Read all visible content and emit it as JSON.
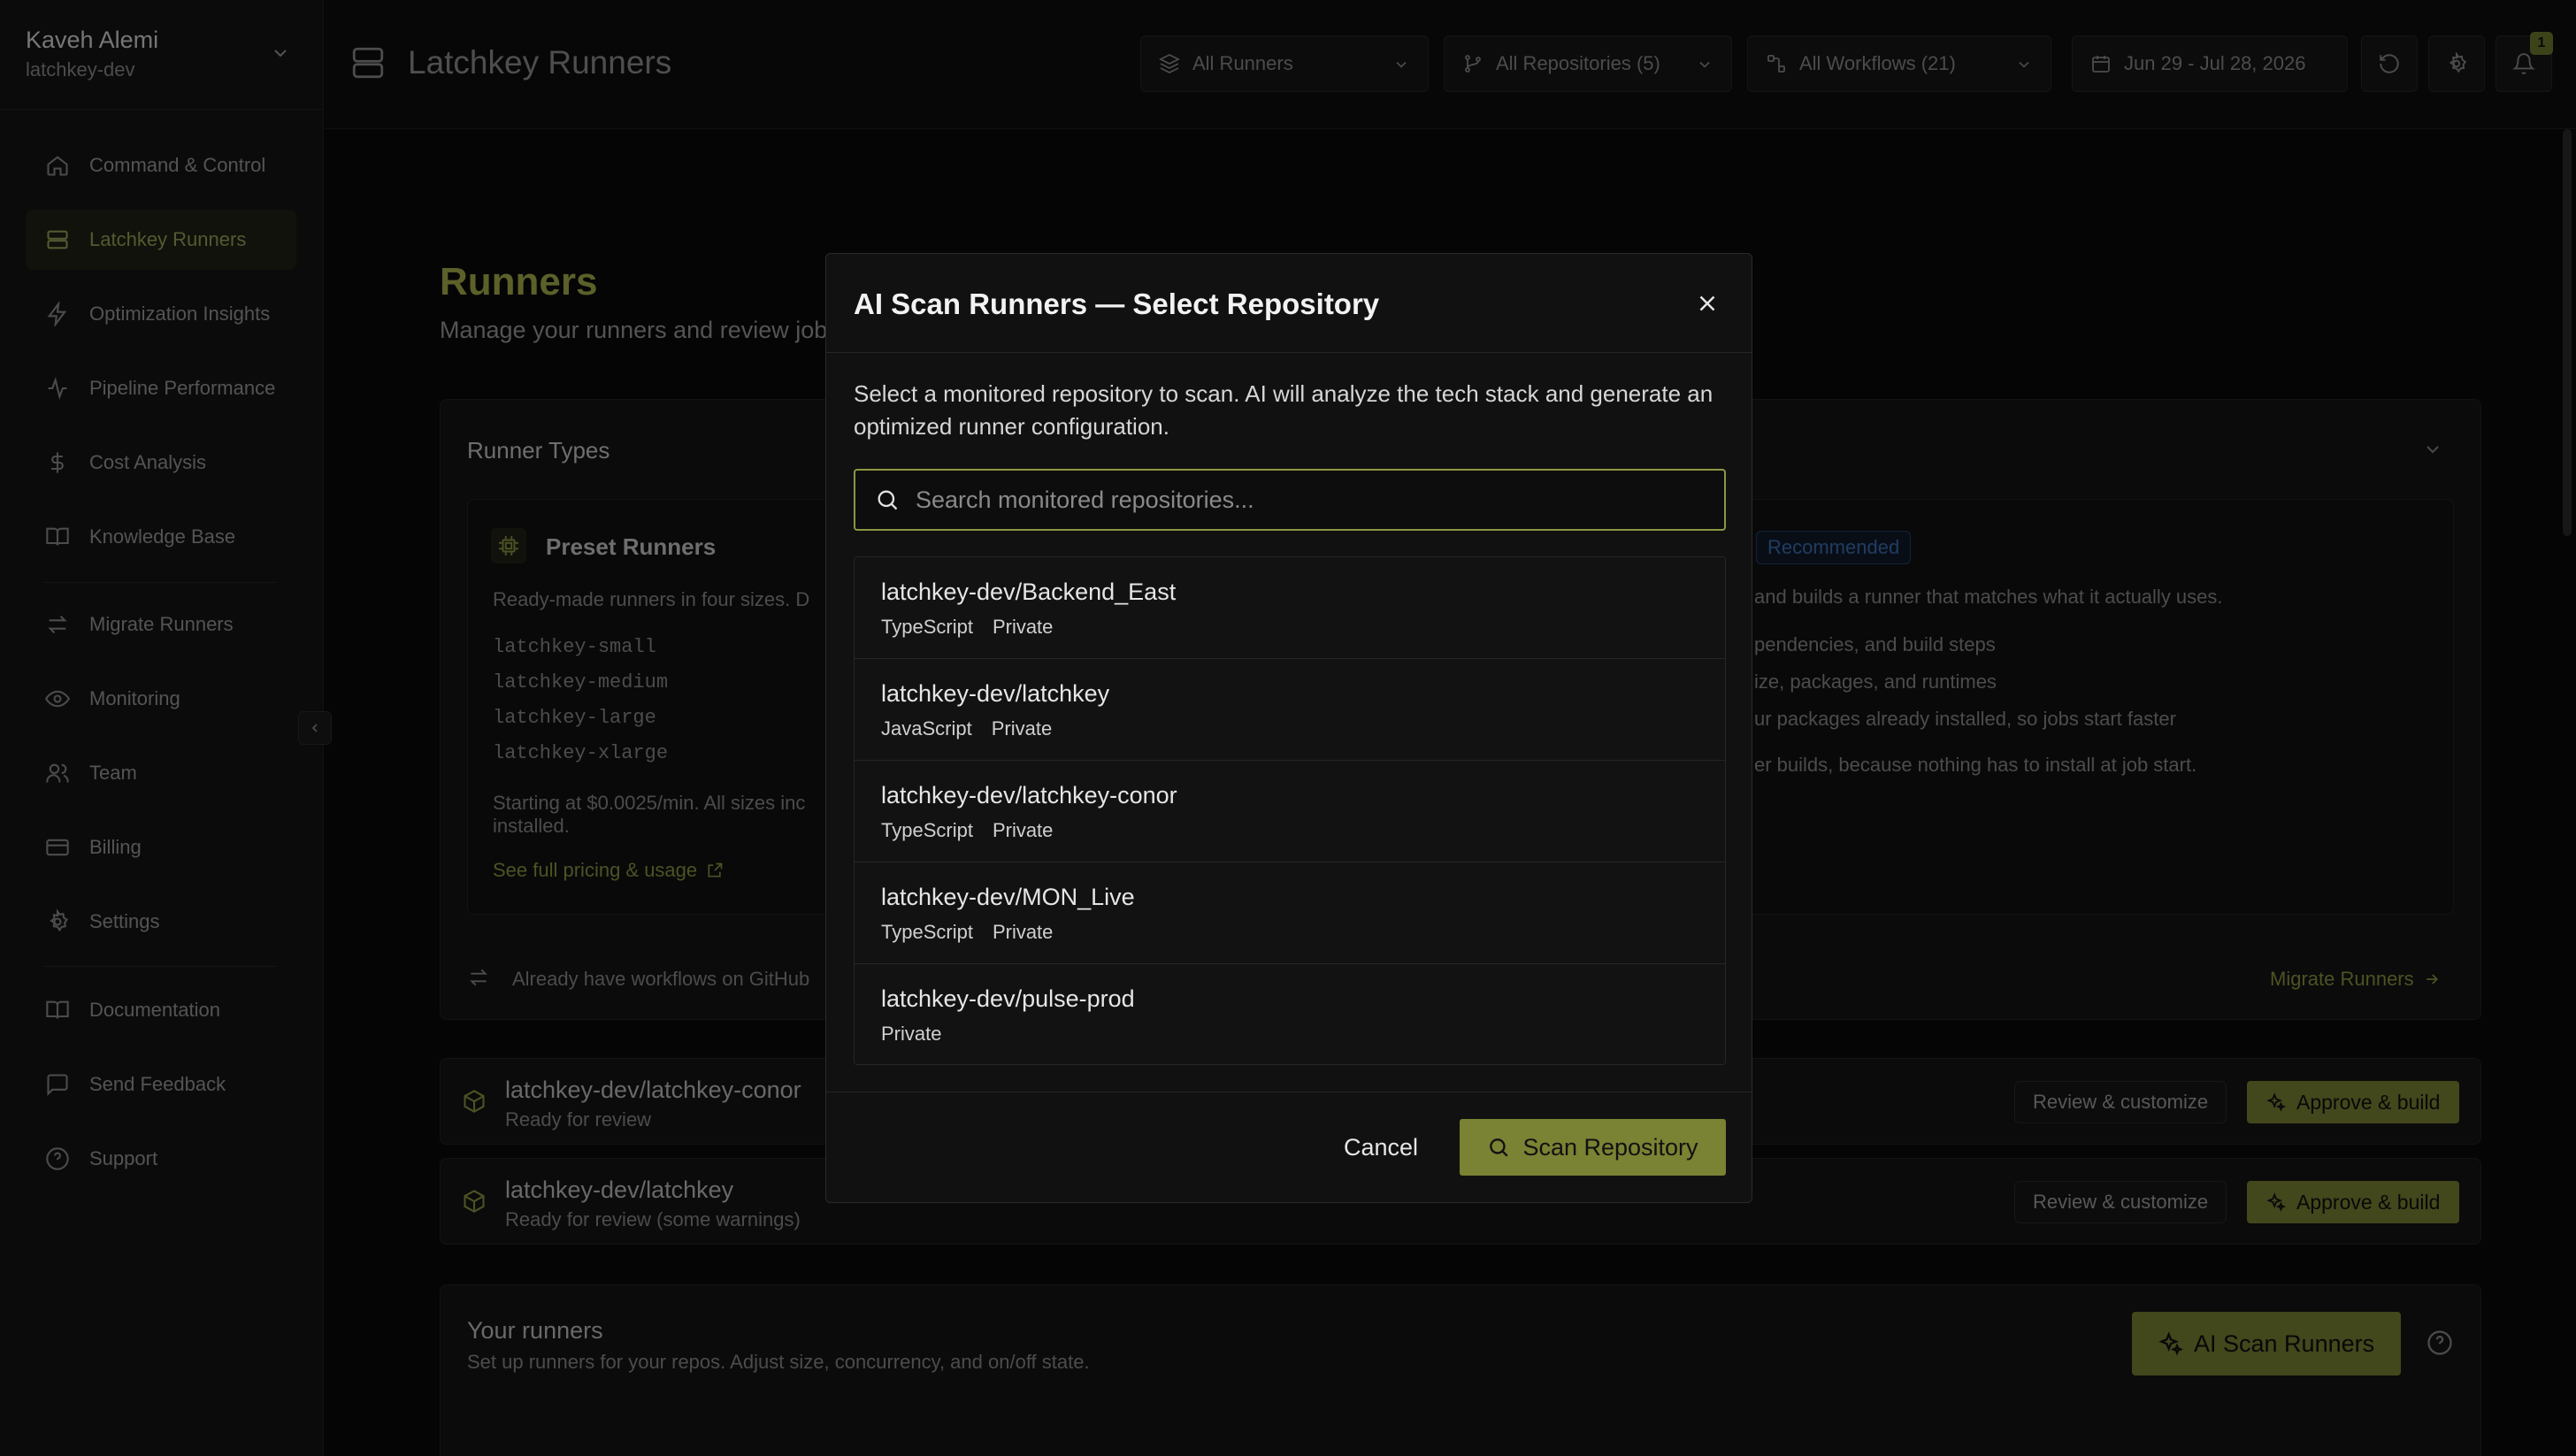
{
  "account": {
    "name": "Kaveh Alemi",
    "org": "latchkey-dev"
  },
  "sidebar": {
    "items": [
      {
        "label": "Command & Control",
        "icon": "home-icon"
      },
      {
        "label": "Latchkey Runners",
        "icon": "server-icon",
        "active": true
      },
      {
        "label": "Optimization Insights",
        "icon": "zap-icon"
      },
      {
        "label": "Pipeline Performance",
        "icon": "activity-icon"
      },
      {
        "label": "Cost Analysis",
        "icon": "dollar-icon"
      },
      {
        "label": "Knowledge Base",
        "icon": "book-icon"
      },
      {
        "label": "Migrate Runners",
        "icon": "arrows-swap-icon"
      },
      {
        "label": "Monitoring",
        "icon": "eye-icon"
      },
      {
        "label": "Team",
        "icon": "users-icon"
      },
      {
        "label": "Billing",
        "icon": "credit-card-icon"
      },
      {
        "label": "Settings",
        "icon": "gear-icon"
      },
      {
        "label": "Documentation",
        "icon": "book-open-icon"
      },
      {
        "label": "Send Feedback",
        "icon": "message-icon"
      },
      {
        "label": "Support",
        "icon": "help-circle-icon"
      }
    ]
  },
  "header": {
    "title": "Latchkey Runners",
    "filters": {
      "runners": "All Runners",
      "repositories": "All Repositories (5)",
      "workflows": "All Workflows (21)",
      "date_range": "Jun 29 - Jul 28, 2026"
    },
    "notification_count": "1"
  },
  "main": {
    "title": "Runners",
    "subtitle": "Manage your runners and review job",
    "runner_types": {
      "title": "Runner Types",
      "preset": {
        "title": "Preset Runners",
        "desc": "Ready-made runners in four sizes. D",
        "sizes": [
          "latchkey-small",
          "latchkey-medium",
          "latchkey-large",
          "latchkey-xlarge"
        ],
        "pricing_line1": "Starting at $0.0025/min. All sizes inc",
        "pricing_line2": "installed.",
        "pricing_link": "See full pricing & usage"
      },
      "custom": {
        "badge": "Recommended",
        "desc": "and builds a runner that matches what it actually uses.",
        "bullets": [
          "pendencies, and build steps",
          "ize, packages, and runtimes",
          "ur packages already installed, so jobs start faster",
          "er builds, because nothing has to install at job start."
        ]
      },
      "migrate_text": "Already have workflows on GitHub",
      "migrate_link": "Migrate Runners"
    },
    "pending": [
      {
        "repo": "latchkey-dev/latchkey-conor",
        "status": "Ready for review"
      },
      {
        "repo": "latchkey-dev/latchkey",
        "status": "Ready for review (some warnings)"
      }
    ],
    "review_label": "Review & customize",
    "approve_label": "Approve & build",
    "your_runners": {
      "title": "Your runners",
      "subtitle": "Set up runners for your repos. Adjust size, concurrency, and on/off state.",
      "ai_scan_label": "AI Scan Runners"
    }
  },
  "modal": {
    "title": "AI Scan Runners — Select Repository",
    "description": "Select a monitored repository to scan. AI will analyze the tech stack and generate an optimized runner configuration.",
    "search_placeholder": "Search monitored repositories...",
    "repos": [
      {
        "name": "latchkey-dev/Backend_East",
        "language": "TypeScript",
        "visibility": "Private"
      },
      {
        "name": "latchkey-dev/latchkey",
        "language": "JavaScript",
        "visibility": "Private"
      },
      {
        "name": "latchkey-dev/latchkey-conor",
        "language": "TypeScript",
        "visibility": "Private"
      },
      {
        "name": "latchkey-dev/MON_Live",
        "language": "TypeScript",
        "visibility": "Private"
      },
      {
        "name": "latchkey-dev/pulse-prod",
        "language": "",
        "visibility": "Private"
      }
    ],
    "cancel_label": "Cancel",
    "scan_label": "Scan Repository"
  },
  "colors": {
    "accent": "#7a8233",
    "accent_text": "#a8b04c",
    "background": "#0a0a0a"
  }
}
